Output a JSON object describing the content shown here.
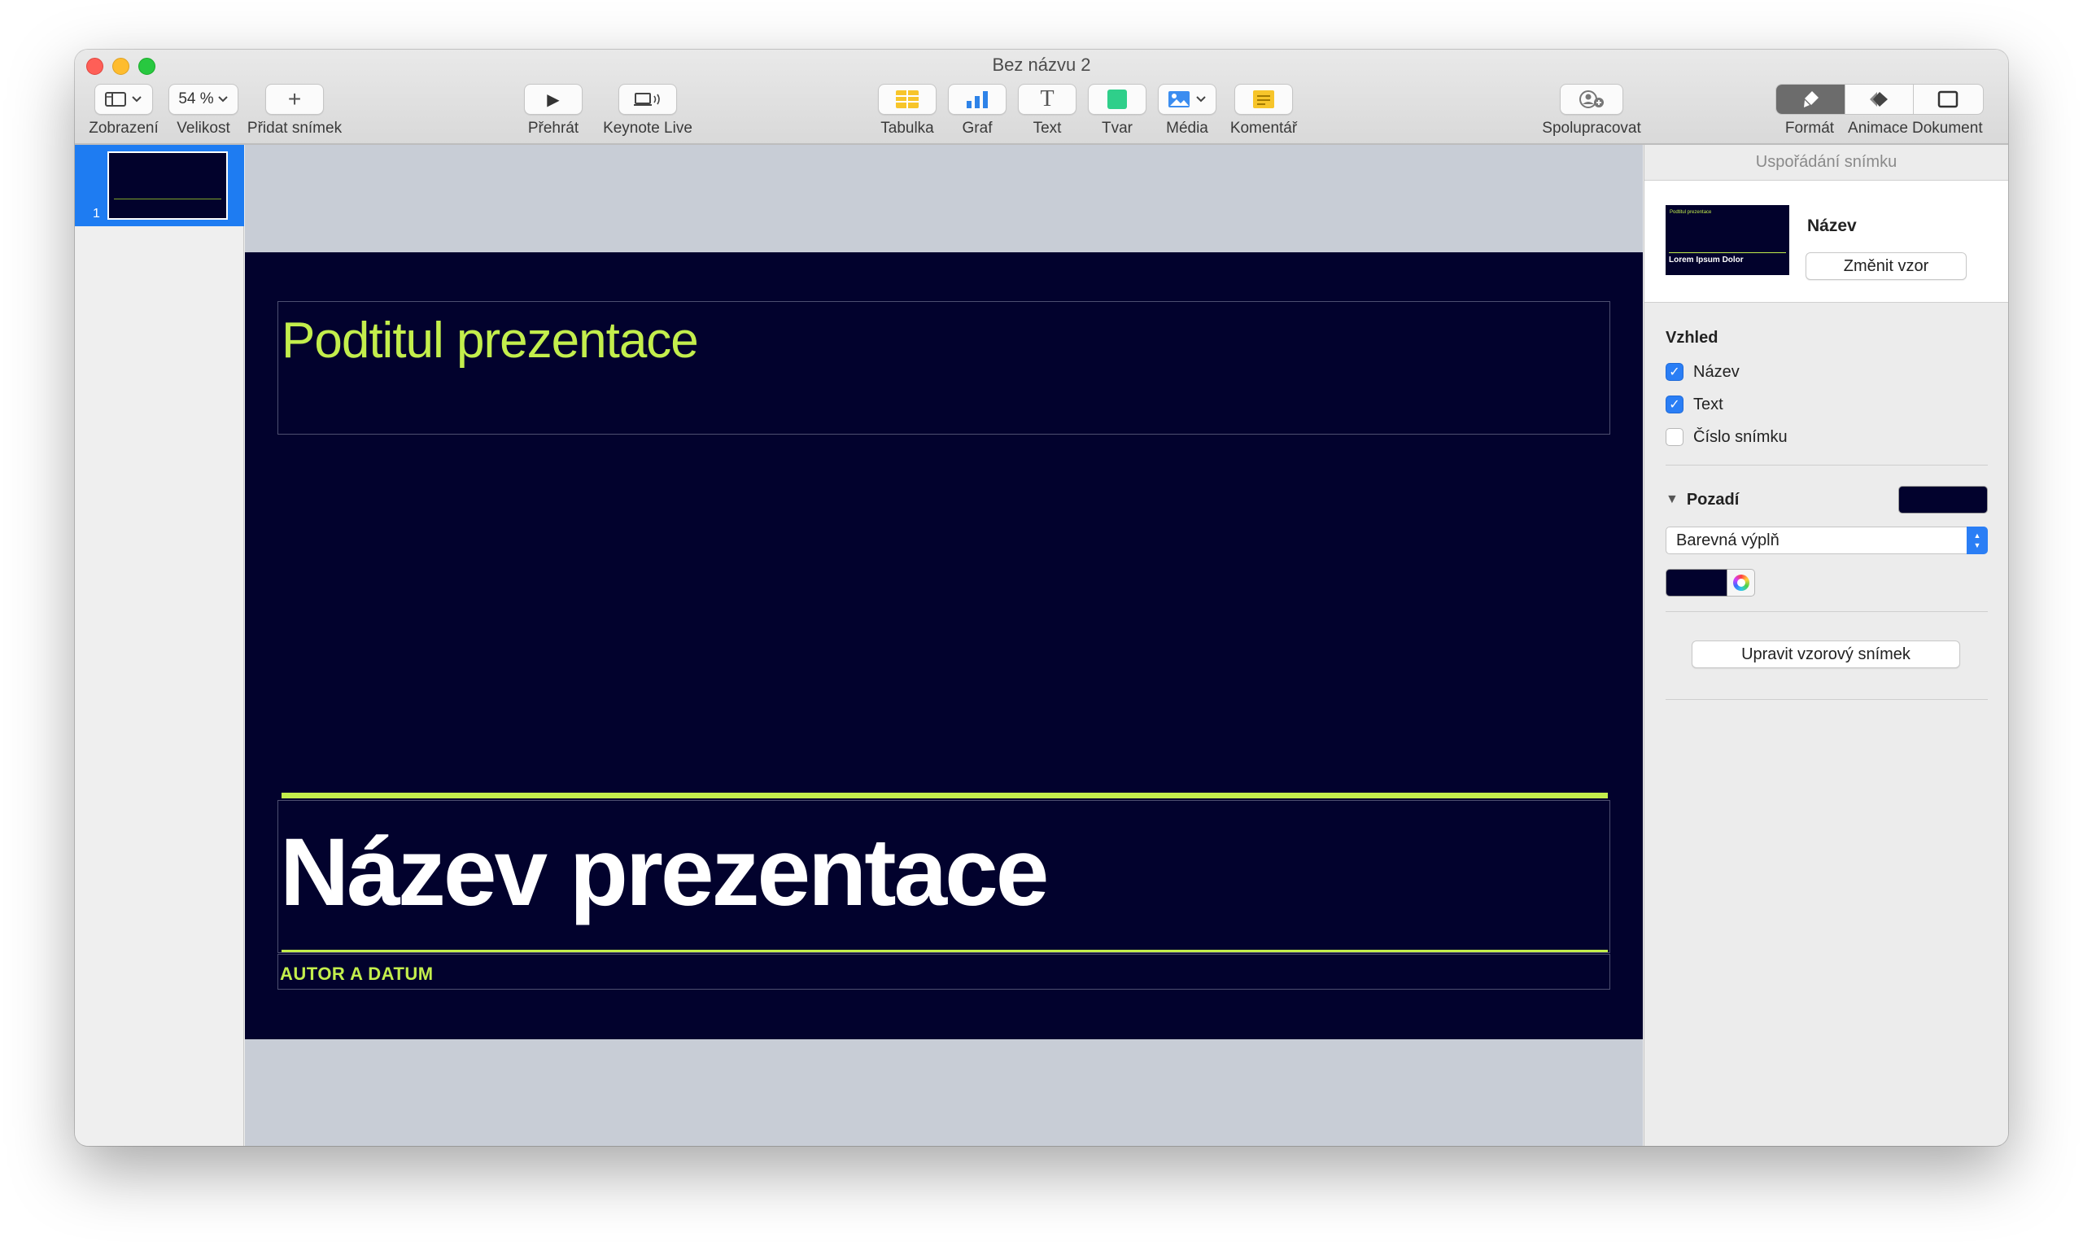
{
  "window": {
    "title": "Bez názvu 2"
  },
  "toolbar": {
    "view_label": "Zobrazení",
    "zoom_value": "54 %",
    "zoom_label": "Velikost",
    "add_slide_icon": "+",
    "add_slide_label": "Přidat snímek",
    "play_icon": "▶",
    "play_label": "Přehrát",
    "keynote_live_label": "Keynote Live",
    "table_label": "Tabulka",
    "chart_label": "Graf",
    "text_icon": "T",
    "text_label": "Text",
    "shape_label": "Tvar",
    "media_label": "Média",
    "comment_label": "Komentář",
    "collaborate_label": "Spolupracovat",
    "format_label": "Formát",
    "animate_label": "Animace",
    "document_label": "Dokument"
  },
  "navigator": {
    "slides": [
      {
        "number": "1"
      }
    ]
  },
  "slide": {
    "subtitle": "Podtitul prezentace",
    "title": "Název prezentace",
    "author": "AUTOR A DATUM",
    "background_color": "#02022d",
    "accent_color": "#c3ee4c"
  },
  "inspector": {
    "header": "Uspořádání snímku",
    "master_thumb_sub": "Podtitul prezentace",
    "master_thumb_title": "Lorem Ipsum Dolor",
    "master_name": "Název",
    "change_master": "Změnit vzor",
    "appearance_title": "Vzhled",
    "checkboxes": [
      {
        "label": "Název",
        "checked": true
      },
      {
        "label": "Text",
        "checked": true
      },
      {
        "label": "Číslo snímku",
        "checked": false
      }
    ],
    "checkmark": "✓",
    "background_title": "Pozadí",
    "disclosure_icon": "▼",
    "fill_type": "Barevná výplň",
    "arrow_up": "▲",
    "arrow_down": "▼",
    "edit_master": "Upravit vzorový snímek"
  }
}
